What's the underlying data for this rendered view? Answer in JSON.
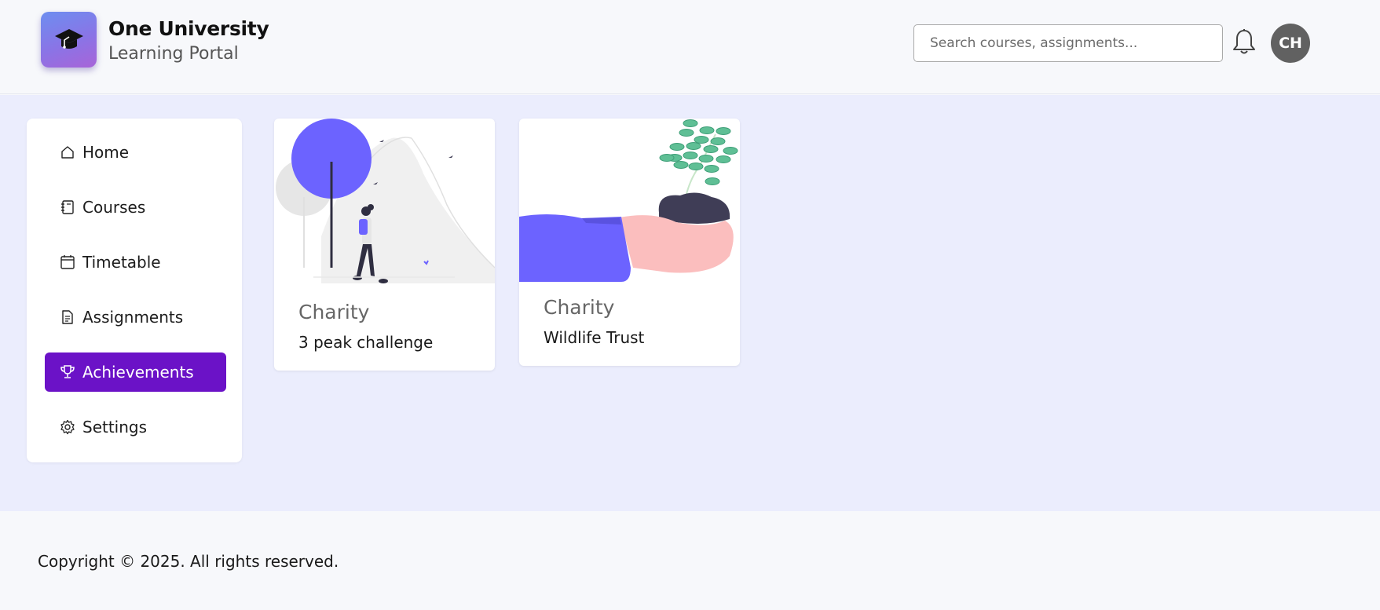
{
  "brand": {
    "title": "One University",
    "subtitle": "Learning Portal",
    "logo_icon": "graduation-cap-icon"
  },
  "header": {
    "search_placeholder": "Search courses, assignments...",
    "notification_icon": "bell-icon",
    "avatar_initials": "CH"
  },
  "sidebar": {
    "items": [
      {
        "label": "Home",
        "icon": "home-icon",
        "active": false
      },
      {
        "label": "Courses",
        "icon": "notebook-icon",
        "active": false
      },
      {
        "label": "Timetable",
        "icon": "calendar-icon",
        "active": false
      },
      {
        "label": "Assignments",
        "icon": "document-icon",
        "active": false
      },
      {
        "label": "Achievements",
        "icon": "trophy-icon",
        "active": true
      },
      {
        "label": "Settings",
        "icon": "gear-icon",
        "active": false
      }
    ]
  },
  "achievements": [
    {
      "category": "Charity",
      "title": "3 peak challenge",
      "illustration": "hiker-mountain-illustration"
    },
    {
      "category": "Charity",
      "title": "Wildlife Trust",
      "illustration": "hand-plant-illustration"
    }
  ],
  "footer": {
    "copyright": "Copyright © 2025. All rights reserved."
  },
  "colors": {
    "accent": "#6b12c7",
    "main_background": "#ebedfd",
    "illustration_primary": "#6c63ff",
    "avatar_background": "#616161"
  }
}
